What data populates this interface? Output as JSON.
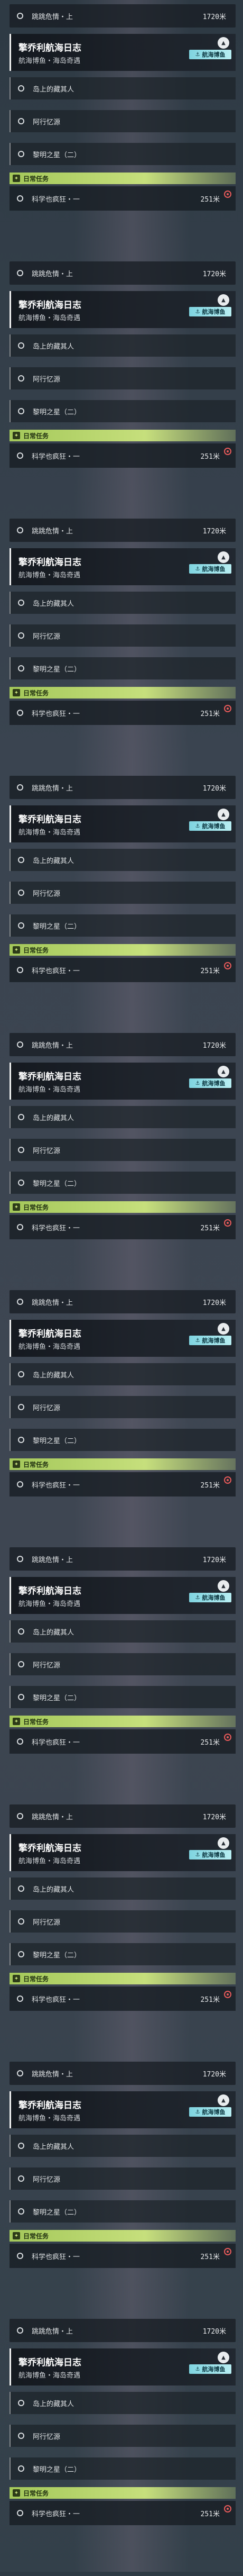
{
  "blocks": [
    {
      "top_row": {
        "label": "跳跳危情・上",
        "distance": "1720米"
      },
      "quest": {
        "title": "擎乔利航海日志",
        "subtitle": "航海博鱼・海岛奇遇",
        "tag": "航海博鱼"
      },
      "subtasks": [
        {
          "label": "岛上的藏其人"
        },
        {
          "label": "阿行忆源"
        },
        {
          "label": "黎明之星（二）"
        }
      ],
      "daily_header": {
        "label": "日常任务"
      },
      "daily": {
        "label": "科学也疯狂・一",
        "distance": "251米"
      }
    },
    {
      "top_row": {
        "label": "跳跳危情・上",
        "distance": "1720米"
      },
      "quest": {
        "title": "擎乔利航海日志",
        "subtitle": "航海博鱼・海岛奇遇",
        "tag": "航海博鱼"
      },
      "subtasks": [
        {
          "label": "岛上的藏其人"
        },
        {
          "label": "阿行忆源"
        },
        {
          "label": "黎明之星（二）"
        }
      ],
      "daily_header": {
        "label": "日常任务"
      },
      "daily": {
        "label": "科学也疯狂・一",
        "distance": "251米"
      }
    },
    {
      "top_row": {
        "label": "跳跳危情・上",
        "distance": "1720米"
      },
      "quest": {
        "title": "擎乔利航海日志",
        "subtitle": "航海博鱼・海岛奇遇",
        "tag": "航海博鱼"
      },
      "subtasks": [
        {
          "label": "岛上的藏其人"
        },
        {
          "label": "阿行忆源"
        },
        {
          "label": "黎明之星（二）"
        }
      ],
      "daily_header": {
        "label": "日常任务"
      },
      "daily": {
        "label": "科学也疯狂・一",
        "distance": "251米"
      }
    },
    {
      "top_row": {
        "label": "跳跳危情・上",
        "distance": "1720米"
      },
      "quest": {
        "title": "擎乔利航海日志",
        "subtitle": "航海博鱼・海岛奇遇",
        "tag": "航海博鱼"
      },
      "subtasks": [
        {
          "label": "岛上的藏其人"
        },
        {
          "label": "阿行忆源"
        },
        {
          "label": "黎明之星（二）"
        }
      ],
      "daily_header": {
        "label": "日常任务"
      },
      "daily": {
        "label": "科学也疯狂・一",
        "distance": "251米"
      }
    },
    {
      "top_row": {
        "label": "跳跳危情・上",
        "distance": "1720米"
      },
      "quest": {
        "title": "擎乔利航海日志",
        "subtitle": "航海博鱼・海岛奇遇",
        "tag": "航海博鱼"
      },
      "subtasks": [
        {
          "label": "岛上的藏其人"
        },
        {
          "label": "阿行忆源"
        },
        {
          "label": "黎明之星（二）"
        }
      ],
      "daily_header": {
        "label": "日常任务"
      },
      "daily": {
        "label": "科学也疯狂・一",
        "distance": "251米"
      }
    },
    {
      "top_row": {
        "label": "跳跳危情・上",
        "distance": "1720米"
      },
      "quest": {
        "title": "擎乔利航海日志",
        "subtitle": "航海博鱼・海岛奇遇",
        "tag": "航海博鱼"
      },
      "subtasks": [
        {
          "label": "岛上的藏其人"
        },
        {
          "label": "阿行忆源"
        },
        {
          "label": "黎明之星（二）"
        }
      ],
      "daily_header": {
        "label": "日常任务"
      },
      "daily": {
        "label": "科学也疯狂・一",
        "distance": "251米"
      }
    },
    {
      "top_row": {
        "label": "跳跳危情・上",
        "distance": "1720米"
      },
      "quest": {
        "title": "擎乔利航海日志",
        "subtitle": "航海博鱼・海岛奇遇",
        "tag": "航海博鱼"
      },
      "subtasks": [
        {
          "label": "岛上的藏其人"
        },
        {
          "label": "阿行忆源"
        },
        {
          "label": "黎明之星（二）"
        }
      ],
      "daily_header": {
        "label": "日常任务"
      },
      "daily": {
        "label": "科学也疯狂・一",
        "distance": "251米"
      }
    },
    {
      "top_row": {
        "label": "跳跳危情・上",
        "distance": "1720米"
      },
      "quest": {
        "title": "擎乔利航海日志",
        "subtitle": "航海博鱼・海岛奇遇",
        "tag": "航海博鱼"
      },
      "subtasks": [
        {
          "label": "岛上的藏其人"
        },
        {
          "label": "阿行忆源"
        },
        {
          "label": "黎明之星（二）"
        }
      ],
      "daily_header": {
        "label": "日常任务"
      },
      "daily": {
        "label": "科学也疯狂・一",
        "distance": "251米"
      }
    },
    {
      "top_row": {
        "label": "跳跳危情・上",
        "distance": "1720米"
      },
      "quest": {
        "title": "擎乔利航海日志",
        "subtitle": "航海博鱼・海岛奇遇",
        "tag": "航海博鱼"
      },
      "subtasks": [
        {
          "label": "岛上的藏其人"
        },
        {
          "label": "阿行忆源"
        },
        {
          "label": "黎明之星（二）"
        }
      ],
      "daily_header": {
        "label": "日常任务"
      },
      "daily": {
        "label": "科学也疯狂・一",
        "distance": "251米"
      }
    },
    {
      "top_row": {
        "label": "跳跳危情・上",
        "distance": "1720米"
      },
      "quest": {
        "title": "擎乔利航海日志",
        "subtitle": "航海博鱼・海岛奇遇",
        "tag": "航海博鱼"
      },
      "subtasks": [
        {
          "label": "岛上的藏其人"
        },
        {
          "label": "阿行忆源"
        },
        {
          "label": "黎明之星（二）"
        }
      ],
      "daily_header": {
        "label": "日常任务"
      },
      "daily": {
        "label": "科学也疯狂・一",
        "distance": "251米"
      }
    }
  ],
  "icons": {
    "collapse": "chevron-up-icon",
    "tag": "ship-icon",
    "daily": "daily-task-icon",
    "marker": "map-marker-icon"
  },
  "colors": {
    "daily_accent": "#a4c85a",
    "tag_accent": "#7fd4e0",
    "marker": "#e85a5a"
  }
}
